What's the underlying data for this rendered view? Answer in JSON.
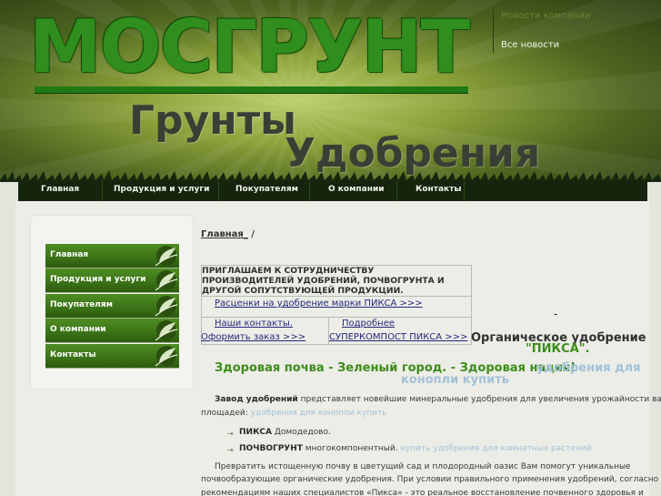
{
  "header": {
    "logo": "МОСГРУНТ",
    "tagline_1": "Грунты",
    "tagline_2": "Удобрения",
    "news_title": "Новости компании",
    "news_all": "Все новости"
  },
  "top_nav": [
    "Главная",
    "Продукция и услуги",
    "Покупателям",
    "О компании",
    "Контакты"
  ],
  "sidebar": [
    "Главная",
    "Продукция и услуги",
    "Покупателям",
    "О компании",
    "Контакты"
  ],
  "breadcrumb": {
    "home": "Главная_",
    "sep": " /"
  },
  "invite": {
    "title": "ПРИГЛАШАЕМ К СОТРУДНИЧЕСТВУ ПРОИЗВОДИТЕЛЕЙ УДОБРЕНИЙ, ПОЧВОГРУНТА И ДРУГОЙ СОПУТСТВУЮЩЕЙ ПРОДУКЦИИ.",
    "prices": "Расценки на удобрение марки ПИКСА >>>",
    "contacts": "Наши контакты.",
    "more": "Подробнее",
    "order": "Оформить заказ >>>",
    "supercompost": "СУПЕРКОМПОСТ ПИКСА >>>"
  },
  "organic": {
    "dash": "-",
    "line1": "Органическое удобрение",
    "line2": "\"ПИКСА\"."
  },
  "slogan": {
    "main": "Здоровая почва - Зеленый город. - Здоровая нация!",
    "extra_1": "удобрения для",
    "extra_2": "конопли купить"
  },
  "body": {
    "p1_bold": "Завод удобрений",
    "p1_text": " представляет новейшие  минеральные удобрения для увеличения урожайности ваших",
    "p1_line2": "площадей:",
    "p1_faint": " удобрения для конопли купить",
    "b1_bold": "ПИКСА",
    "b1_text": " Домодедово.",
    "b2_bold": "ПОЧВОГРУНТ",
    "b2_text": " многокомпонентный.",
    "b2_faint": " купить удобрения для комнатных растений",
    "p2_l1": "Превратить истощенную почву в цветущий сад и плодородный оазис Вам помогут уникальные",
    "p2_l2": "почвообразующие органические удобрения. При условии правильного применения удобрений, согласно",
    "p2_l3": "рекомендациям наших специалистов «Пикса» - это реальное восстановление почвенного здоровья и"
  },
  "colors": {
    "nav_bg": "#15240c",
    "accent_green": "#3c8d19",
    "link_blue": "#25287a",
    "faint_text": "#a3c1d8"
  }
}
